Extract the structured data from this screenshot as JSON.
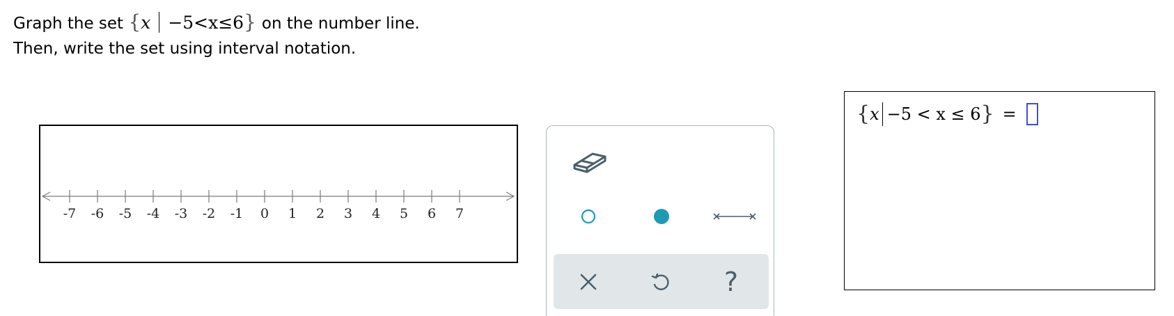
{
  "prompt": {
    "line1_prefix": "Graph the set",
    "line1_suffix": "on the number line.",
    "set": {
      "open_brace": "{",
      "variable": "x",
      "condition": "−5<x≤6",
      "close_brace": "}"
    },
    "line2": "Then, write the set using interval notation."
  },
  "number_line": {
    "ticks": [
      "-7",
      "-6",
      "-5",
      "-4",
      "-3",
      "-2",
      "-1",
      "0",
      "1",
      "2",
      "3",
      "4",
      "5",
      "6",
      "7"
    ]
  },
  "palette": {
    "tools": {
      "eraser": "eraser-icon",
      "open_point": "open-circle-icon",
      "closed_point": "filled-circle-icon",
      "segment": "segment-icon"
    },
    "actions": {
      "clear": "×",
      "undo": "undo-icon",
      "help": "?"
    },
    "accent_color": "#1e9ab5"
  },
  "answer": {
    "open_brace": "{",
    "variable": "x",
    "condition": "−5 < x ≤ 6",
    "close_brace": "}",
    "equals": "=",
    "input_value": ""
  }
}
